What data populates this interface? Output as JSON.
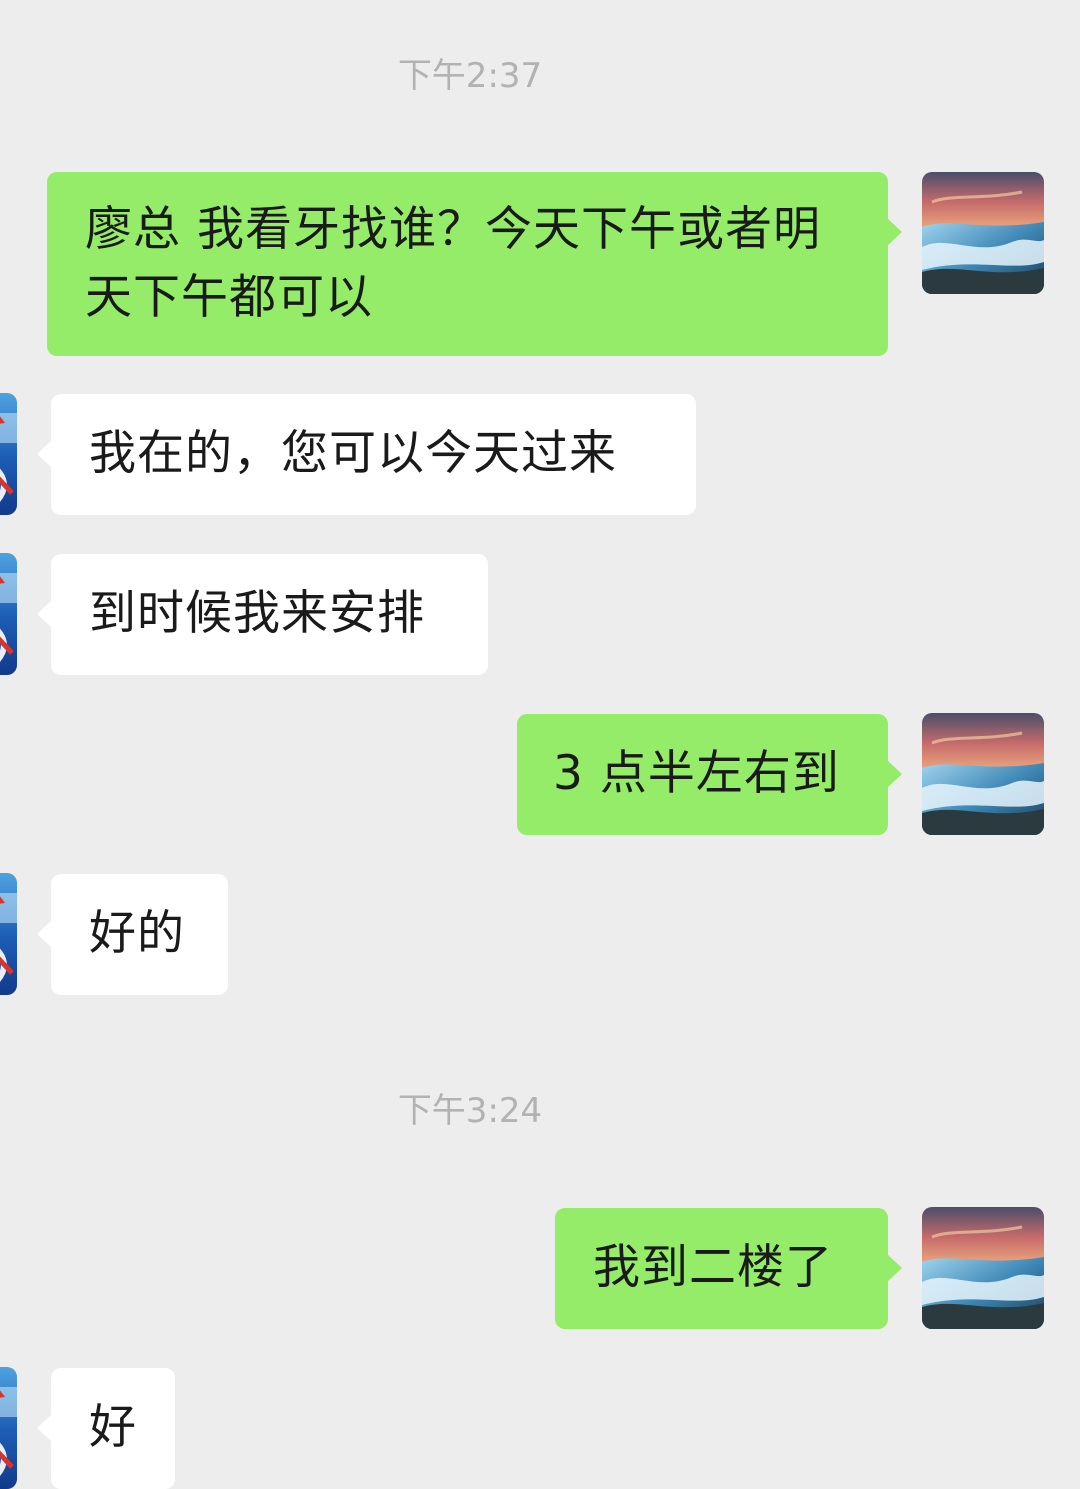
{
  "chat": {
    "timestamps": [
      "下午2:37",
      "下午3:24"
    ],
    "messages": [
      {
        "sender": "self",
        "text": "廖总 我看牙找谁？今天下午或者明天下午都可以"
      },
      {
        "sender": "other",
        "text": "我在的，您可以今天过来"
      },
      {
        "sender": "other",
        "text": "到时候我来安排"
      },
      {
        "sender": "self",
        "text": "3 点半左右到"
      },
      {
        "sender": "other",
        "text": "好的"
      },
      {
        "sender": "self",
        "text": "我到二楼了"
      },
      {
        "sender": "other",
        "text": "好"
      }
    ]
  },
  "colors": {
    "background": "#ededed",
    "sent_bubble": "#95ec69",
    "received_bubble": "#ffffff",
    "timestamp_text": "#b2b2b2"
  },
  "avatars": {
    "self": "ocean-sunset-avatar",
    "other": "blue-calligraphy-avatar"
  }
}
